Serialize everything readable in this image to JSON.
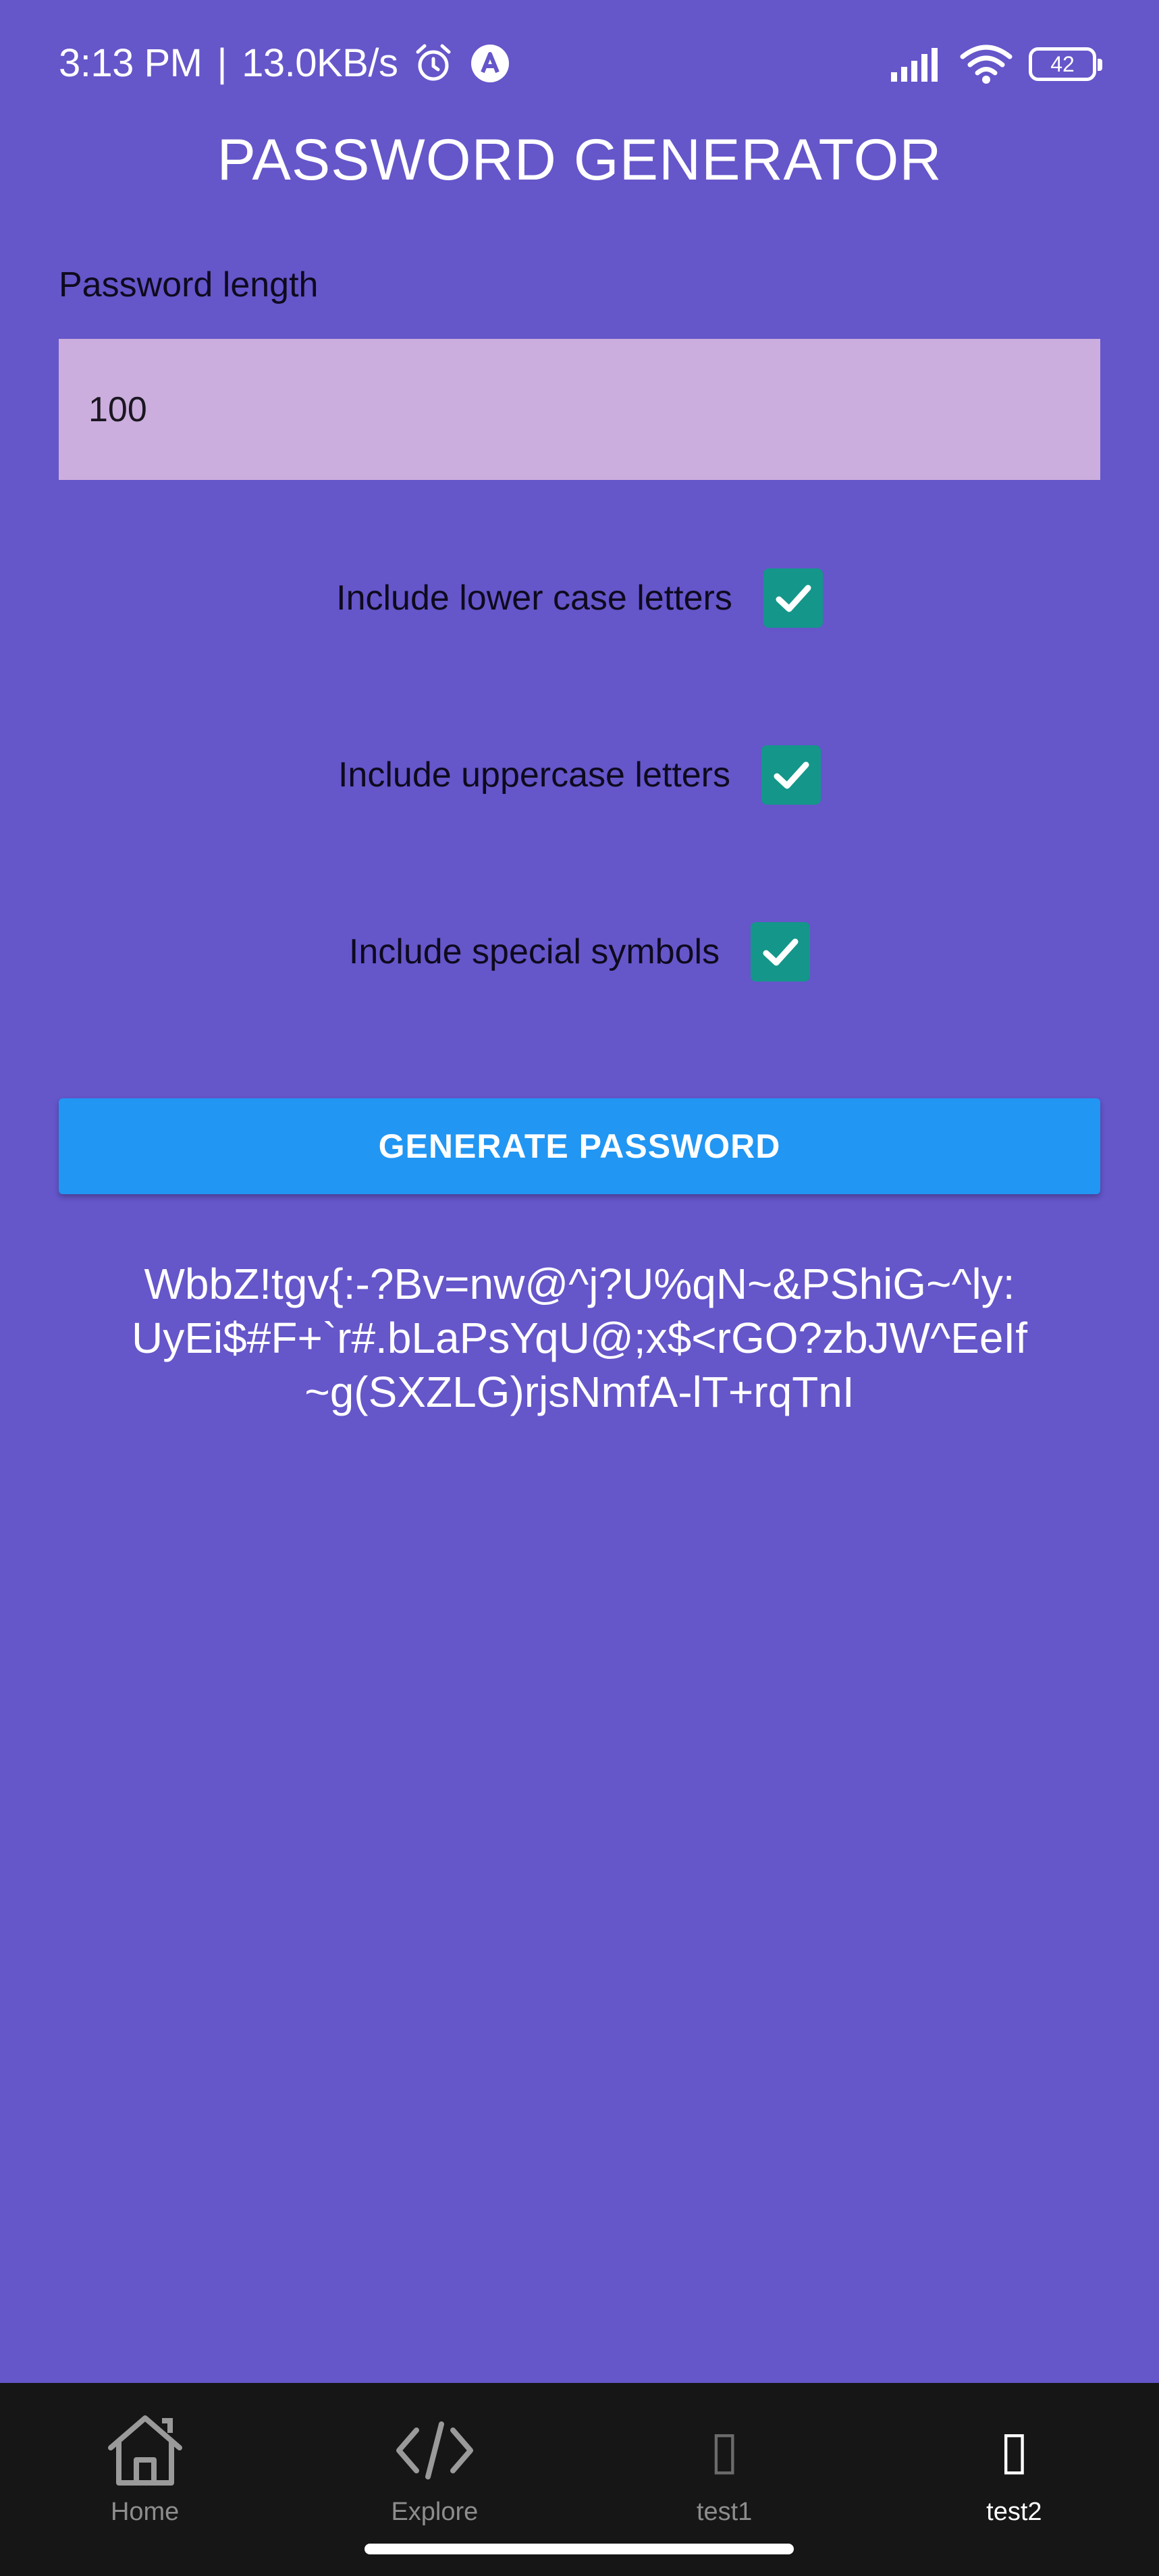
{
  "status_bar": {
    "time": "3:13 PM",
    "separator": "|",
    "net_speed": "13.0KB/s",
    "battery": "42",
    "icons": [
      "alarm-icon",
      "app-notification-icon",
      "signal-icon",
      "wifi-icon",
      "battery-icon"
    ]
  },
  "title": "PASSWORD GENERATOR",
  "length_field": {
    "label": "Password length",
    "value": "100"
  },
  "options": [
    {
      "label": "Include lower case letters",
      "checked": true
    },
    {
      "label": "Include uppercase letters",
      "checked": true
    },
    {
      "label": "Include special symbols",
      "checked": true
    }
  ],
  "generate_button": "GENERATE PASSWORD",
  "password": "WbbZ!tgv{:-?Bv=nw@^j?U%qN~&PShiG~^ly:UyEi$#F+`r#.bLaPsYqU@;x$<rGO?zbJW^EeIf~g(SXZLG)rjsNmfA-lT+rqTnI",
  "bottom_nav": {
    "items": [
      {
        "label": "Home",
        "icon": "home-icon"
      },
      {
        "label": "Explore",
        "icon": "code-icon"
      },
      {
        "label": "test1",
        "icon": "missing-glyph-icon",
        "glyph": "▯"
      },
      {
        "label": "test2",
        "icon": "missing-glyph-icon",
        "glyph": "▯"
      }
    ],
    "active": "test2"
  },
  "colors": {
    "background": "#6556ca",
    "input_background": "#cbaedd",
    "checkbox": "#14968a",
    "button": "#2196f3",
    "nav_background": "#161616"
  }
}
